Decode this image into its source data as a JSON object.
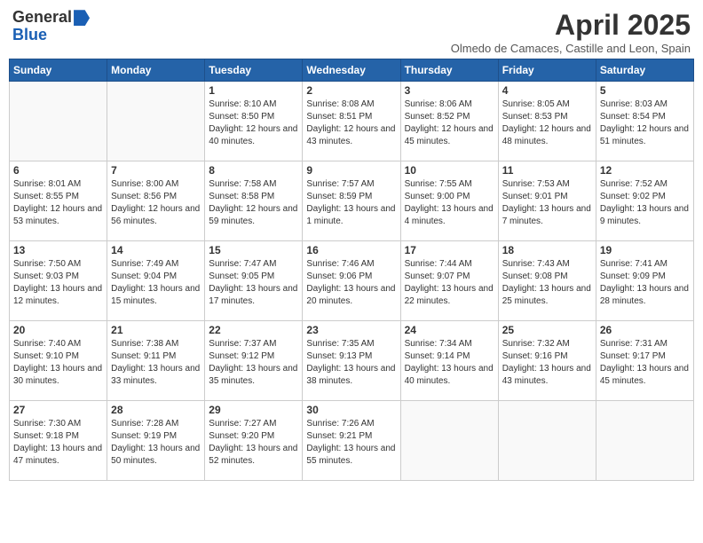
{
  "header": {
    "logo_general": "General",
    "logo_blue": "Blue",
    "month_title": "April 2025",
    "subtitle": "Olmedo de Camaces, Castille and Leon, Spain"
  },
  "calendar": {
    "days_of_week": [
      "Sunday",
      "Monday",
      "Tuesday",
      "Wednesday",
      "Thursday",
      "Friday",
      "Saturday"
    ],
    "weeks": [
      [
        {
          "day": "",
          "info": ""
        },
        {
          "day": "",
          "info": ""
        },
        {
          "day": "1",
          "info": "Sunrise: 8:10 AM\nSunset: 8:50 PM\nDaylight: 12 hours and 40 minutes."
        },
        {
          "day": "2",
          "info": "Sunrise: 8:08 AM\nSunset: 8:51 PM\nDaylight: 12 hours and 43 minutes."
        },
        {
          "day": "3",
          "info": "Sunrise: 8:06 AM\nSunset: 8:52 PM\nDaylight: 12 hours and 45 minutes."
        },
        {
          "day": "4",
          "info": "Sunrise: 8:05 AM\nSunset: 8:53 PM\nDaylight: 12 hours and 48 minutes."
        },
        {
          "day": "5",
          "info": "Sunrise: 8:03 AM\nSunset: 8:54 PM\nDaylight: 12 hours and 51 minutes."
        }
      ],
      [
        {
          "day": "6",
          "info": "Sunrise: 8:01 AM\nSunset: 8:55 PM\nDaylight: 12 hours and 53 minutes."
        },
        {
          "day": "7",
          "info": "Sunrise: 8:00 AM\nSunset: 8:56 PM\nDaylight: 12 hours and 56 minutes."
        },
        {
          "day": "8",
          "info": "Sunrise: 7:58 AM\nSunset: 8:58 PM\nDaylight: 12 hours and 59 minutes."
        },
        {
          "day": "9",
          "info": "Sunrise: 7:57 AM\nSunset: 8:59 PM\nDaylight: 13 hours and 1 minute."
        },
        {
          "day": "10",
          "info": "Sunrise: 7:55 AM\nSunset: 9:00 PM\nDaylight: 13 hours and 4 minutes."
        },
        {
          "day": "11",
          "info": "Sunrise: 7:53 AM\nSunset: 9:01 PM\nDaylight: 13 hours and 7 minutes."
        },
        {
          "day": "12",
          "info": "Sunrise: 7:52 AM\nSunset: 9:02 PM\nDaylight: 13 hours and 9 minutes."
        }
      ],
      [
        {
          "day": "13",
          "info": "Sunrise: 7:50 AM\nSunset: 9:03 PM\nDaylight: 13 hours and 12 minutes."
        },
        {
          "day": "14",
          "info": "Sunrise: 7:49 AM\nSunset: 9:04 PM\nDaylight: 13 hours and 15 minutes."
        },
        {
          "day": "15",
          "info": "Sunrise: 7:47 AM\nSunset: 9:05 PM\nDaylight: 13 hours and 17 minutes."
        },
        {
          "day": "16",
          "info": "Sunrise: 7:46 AM\nSunset: 9:06 PM\nDaylight: 13 hours and 20 minutes."
        },
        {
          "day": "17",
          "info": "Sunrise: 7:44 AM\nSunset: 9:07 PM\nDaylight: 13 hours and 22 minutes."
        },
        {
          "day": "18",
          "info": "Sunrise: 7:43 AM\nSunset: 9:08 PM\nDaylight: 13 hours and 25 minutes."
        },
        {
          "day": "19",
          "info": "Sunrise: 7:41 AM\nSunset: 9:09 PM\nDaylight: 13 hours and 28 minutes."
        }
      ],
      [
        {
          "day": "20",
          "info": "Sunrise: 7:40 AM\nSunset: 9:10 PM\nDaylight: 13 hours and 30 minutes."
        },
        {
          "day": "21",
          "info": "Sunrise: 7:38 AM\nSunset: 9:11 PM\nDaylight: 13 hours and 33 minutes."
        },
        {
          "day": "22",
          "info": "Sunrise: 7:37 AM\nSunset: 9:12 PM\nDaylight: 13 hours and 35 minutes."
        },
        {
          "day": "23",
          "info": "Sunrise: 7:35 AM\nSunset: 9:13 PM\nDaylight: 13 hours and 38 minutes."
        },
        {
          "day": "24",
          "info": "Sunrise: 7:34 AM\nSunset: 9:14 PM\nDaylight: 13 hours and 40 minutes."
        },
        {
          "day": "25",
          "info": "Sunrise: 7:32 AM\nSunset: 9:16 PM\nDaylight: 13 hours and 43 minutes."
        },
        {
          "day": "26",
          "info": "Sunrise: 7:31 AM\nSunset: 9:17 PM\nDaylight: 13 hours and 45 minutes."
        }
      ],
      [
        {
          "day": "27",
          "info": "Sunrise: 7:30 AM\nSunset: 9:18 PM\nDaylight: 13 hours and 47 minutes."
        },
        {
          "day": "28",
          "info": "Sunrise: 7:28 AM\nSunset: 9:19 PM\nDaylight: 13 hours and 50 minutes."
        },
        {
          "day": "29",
          "info": "Sunrise: 7:27 AM\nSunset: 9:20 PM\nDaylight: 13 hours and 52 minutes."
        },
        {
          "day": "30",
          "info": "Sunrise: 7:26 AM\nSunset: 9:21 PM\nDaylight: 13 hours and 55 minutes."
        },
        {
          "day": "",
          "info": ""
        },
        {
          "day": "",
          "info": ""
        },
        {
          "day": "",
          "info": ""
        }
      ]
    ]
  }
}
